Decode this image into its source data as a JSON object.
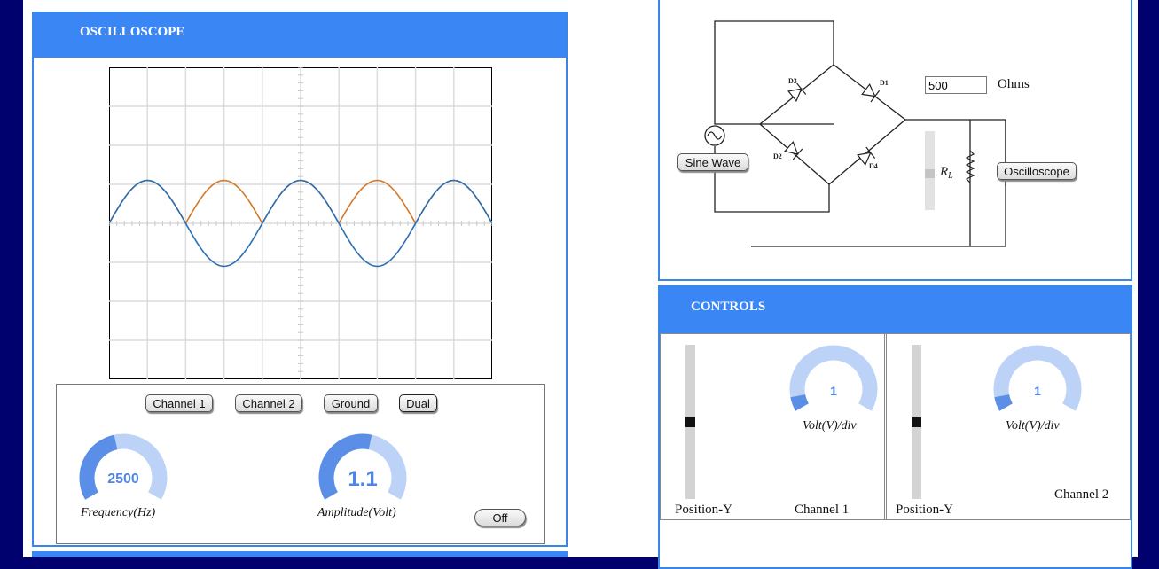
{
  "oscilloscope": {
    "title": "OSCILLOSCOPE",
    "buttons": {
      "ch1": "Channel 1",
      "ch2": "Channel 2",
      "ground": "Ground",
      "dual": "Dual",
      "off": "Off"
    },
    "frequency": {
      "value": "2500",
      "label": "Frequency(Hz)",
      "fraction": 0.45
    },
    "amplitude": {
      "value": "1.1",
      "label": "Amplitude(Volt)",
      "fraction": 0.55
    },
    "trace_colors": {
      "full_wave": "#d4782a",
      "half_wave": "#2b6fb5"
    }
  },
  "circuit": {
    "source_button": "Sine Wave",
    "scope_button": "Oscilloscope",
    "resistance_value": "500",
    "resistance_unit": "Ohms",
    "diodes": [
      "D1",
      "D2",
      "D3",
      "D4"
    ],
    "load_label": "RL"
  },
  "controls": {
    "title": "CONTROLS",
    "channel1": {
      "position_label": "Position-Y",
      "knob_value": "1",
      "knob_label": "Volt(V)/div",
      "channel_label": "Channel 1",
      "fraction": 0.08
    },
    "channel2": {
      "position_label": "Position-Y",
      "knob_value": "1",
      "knob_label": "Volt(V)/div",
      "channel_label": "Channel 2",
      "fraction": 0.08
    }
  },
  "colors": {
    "accent": "#3a86f5",
    "background": "#00006e",
    "knob_light": "#bcd3f7",
    "knob_dark": "#5b8ee6"
  }
}
